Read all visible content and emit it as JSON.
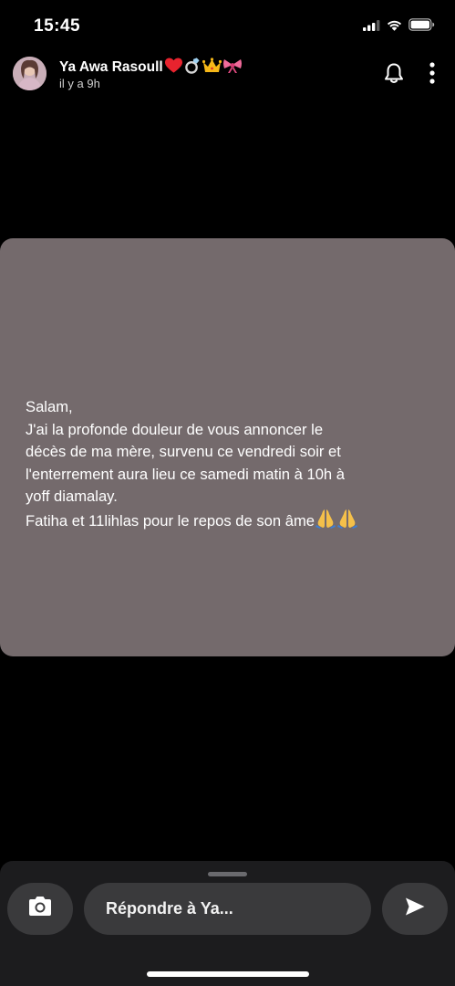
{
  "status_bar": {
    "time": "15:45",
    "icons": [
      "signal-icon",
      "wifi-icon",
      "battery-icon"
    ]
  },
  "header": {
    "username": "Ya Awa Rasoull",
    "emojis": [
      "red-heart-emoji",
      "ring-emoji",
      "crown-emoji",
      "ribbon-emoji"
    ],
    "timestamp": "il y a 9h",
    "icons": [
      "avatar",
      "bell-icon",
      "more-icon"
    ]
  },
  "story": {
    "background": "#746a6c",
    "lines": [
      "Salam,",
      "J'ai la profonde douleur de vous annoncer le",
      "décès de ma mère, survenu ce vendredi soir et",
      "l'enterrement aura lieu  ce samedi matin à 10h à",
      "yoff diamalay.",
      "Fatiha et 11lihlas pour le repos de son âme"
    ],
    "trailing_emojis": [
      "folded-hands-emoji",
      "folded-hands-emoji"
    ]
  },
  "reply_bar": {
    "placeholder": "Répondre à Ya...",
    "icons": [
      "camera-icon",
      "send-icon"
    ]
  }
}
